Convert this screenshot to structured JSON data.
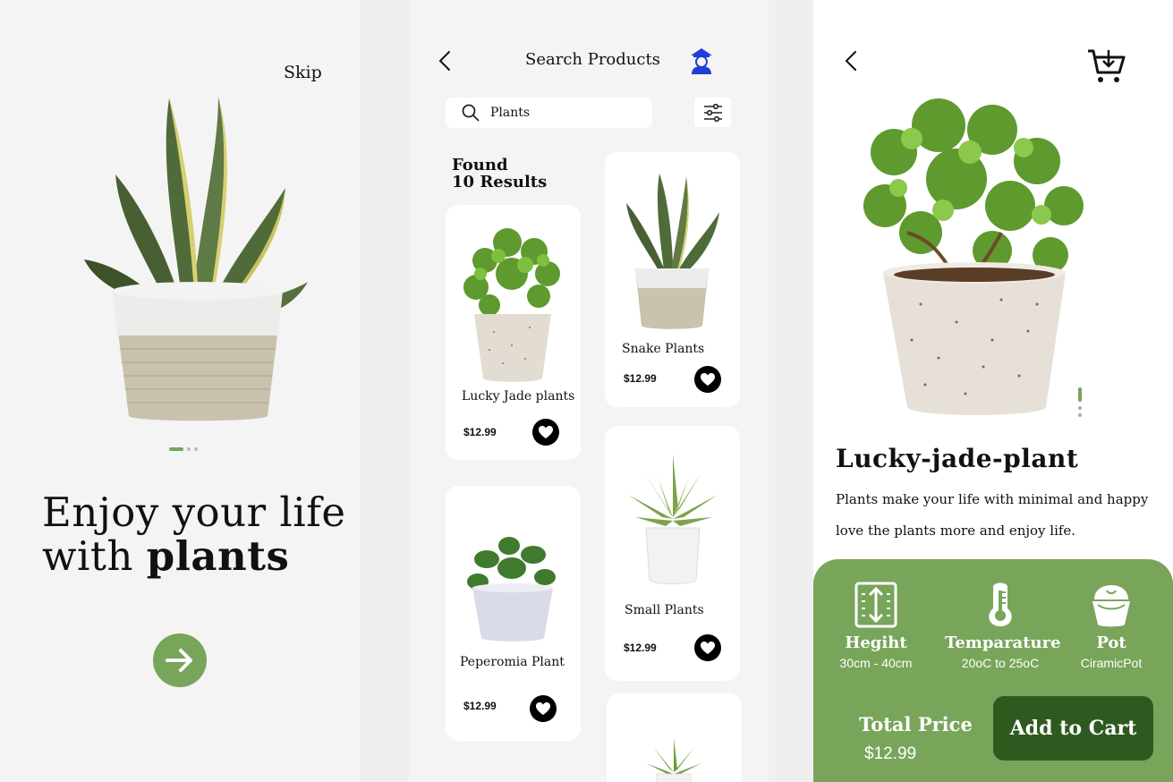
{
  "onboarding": {
    "skip_label": "Skip",
    "headline_line1": "Enjoy your life",
    "headline_line2_prefix": "with",
    "headline_line2_bold": "plants",
    "page_count": 3,
    "active_page": 1,
    "accent_color": "#78a55a"
  },
  "search": {
    "title": "Search Products",
    "query": "Plants",
    "found_line1": "Found",
    "found_line2": "10 Results",
    "products": [
      {
        "name": "Lucky Jade plants",
        "price": "$12.99"
      },
      {
        "name": "Snake Plants",
        "price": "$12.99"
      },
      {
        "name": "Peperomia Plant",
        "price": "$12.99"
      },
      {
        "name": "Small Plants",
        "price": "$12.99"
      }
    ]
  },
  "detail": {
    "title": "Lucky-jade-plant",
    "description": "Plants make your life with minimal and happy love the plants more and enjoy life.",
    "specs": [
      {
        "label": "Hegiht",
        "value": "30cm - 40cm",
        "icon": "height-icon"
      },
      {
        "label": "Temparature",
        "value": "20oC to 25oC",
        "icon": "thermometer-icon"
      },
      {
        "label": "Pot",
        "value": "CiramicPot",
        "icon": "pot-icon"
      }
    ],
    "total_label": "Total Price",
    "total_price": "$12.99",
    "add_to_cart_label": "Add to Cart",
    "panel_color": "#78a55a",
    "button_color": "#2f5a1f"
  }
}
